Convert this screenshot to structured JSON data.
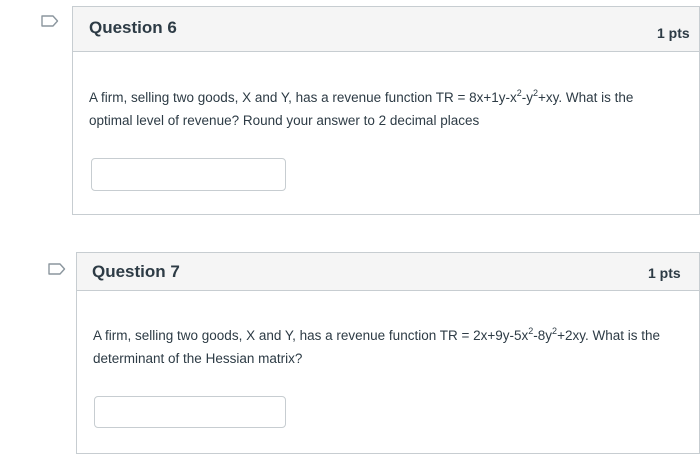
{
  "questions": [
    {
      "title": "Question 6",
      "points": "1 pts",
      "text_before": "A firm, selling two goods, X and Y, has a revenue function TR = 8x+1y-x",
      "sup1": "2",
      "text_mid": "-y",
      "sup2": "2",
      "text_line1_end": "+xy. What is the",
      "text_line2": "optimal level of revenue? Round your answer to 2 decimal places",
      "answer_value": ""
    },
    {
      "title": "Question 7",
      "points": "1 pts",
      "text_before": "A firm, selling two goods, X and Y, has a revenue function TR = 2x+9y-5x",
      "sup1": "2",
      "text_mid": "-8y",
      "sup2": "2",
      "text_line1_end": "+2xy. What is the",
      "text_line2": "determinant of the Hessian matrix?",
      "answer_value": ""
    }
  ],
  "colors": {
    "header_bg": "#f5f5f5",
    "border": "#c7cdd1",
    "text": "#2d3b45",
    "flag_outline": "#8b969e"
  },
  "icons": {
    "flag": "bookmark-flag-icon"
  }
}
